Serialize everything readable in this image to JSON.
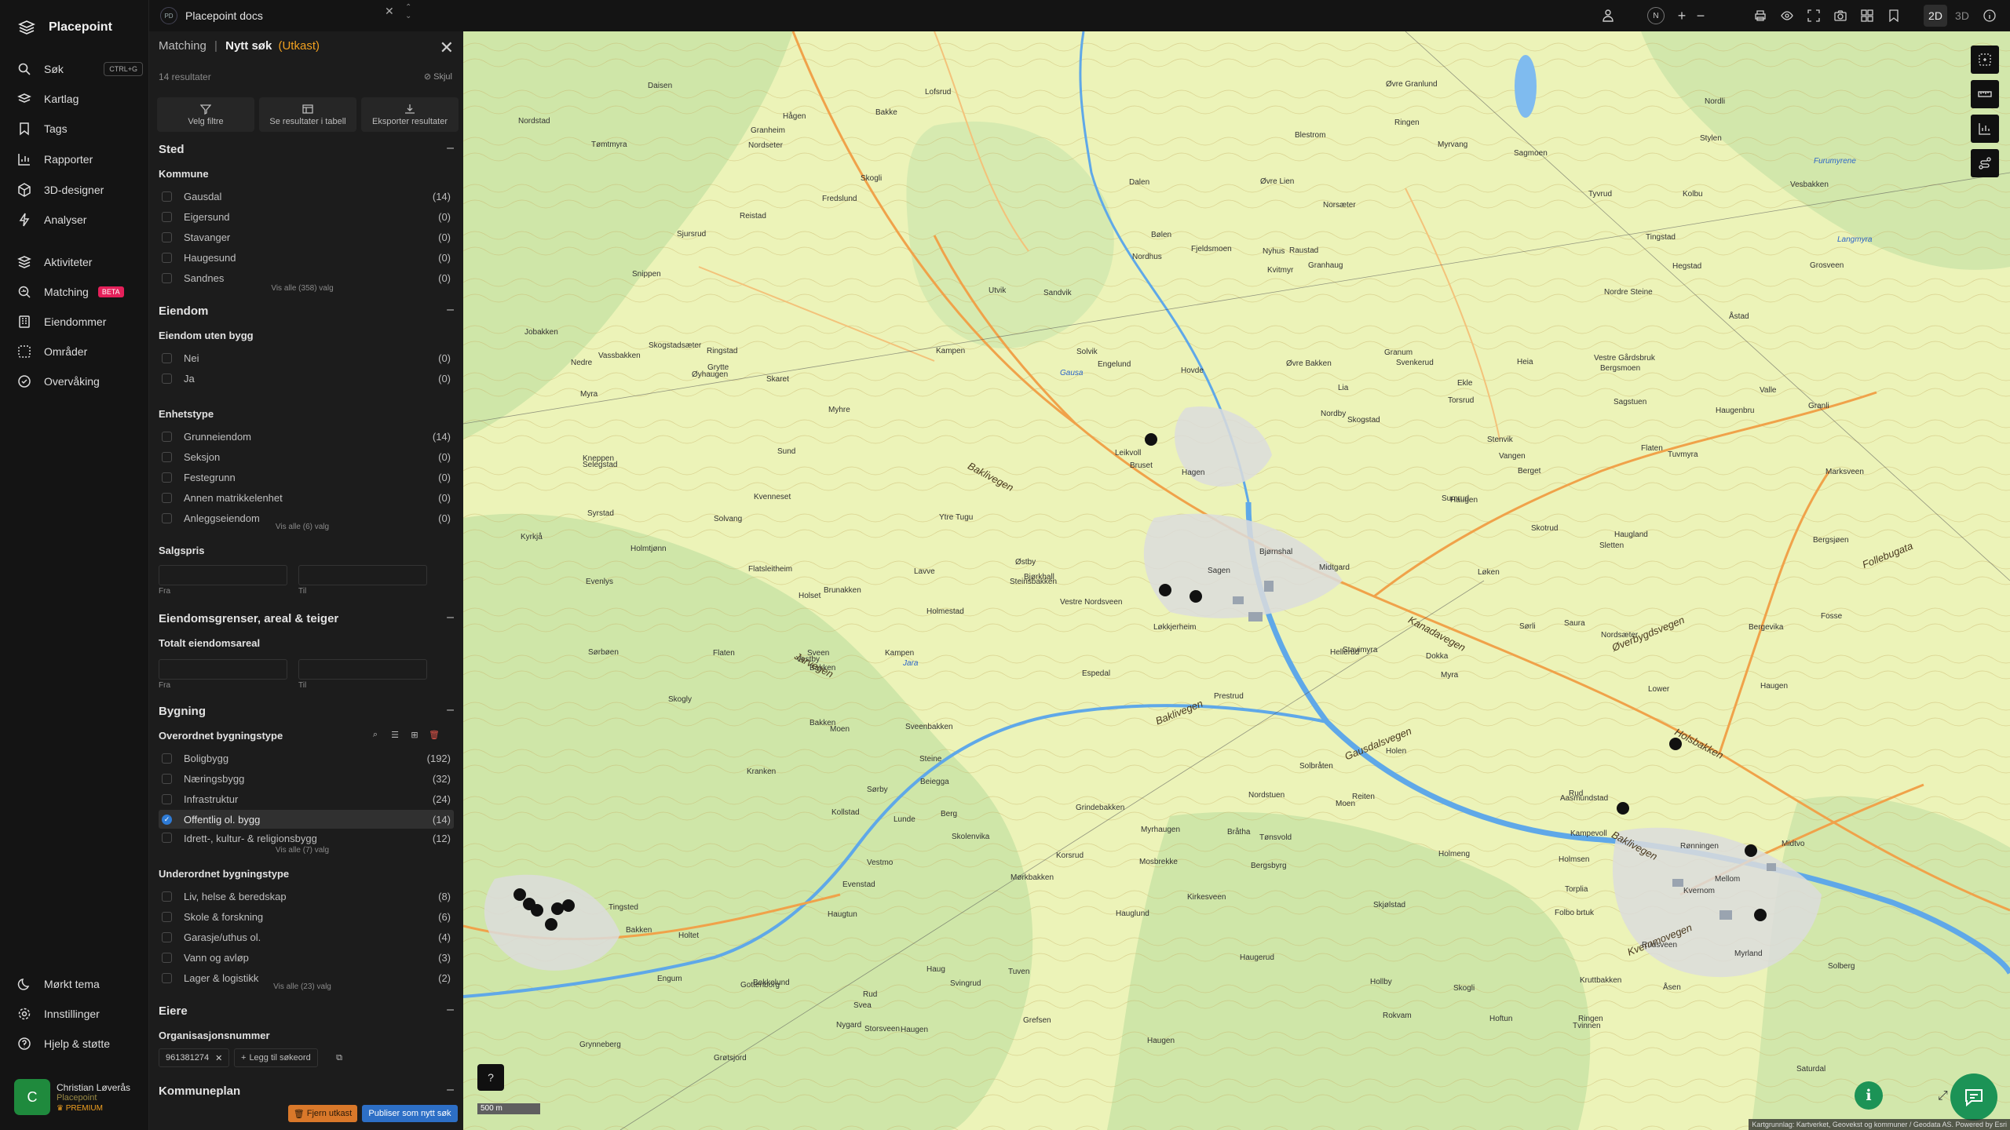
{
  "app": {
    "name": "Placepoint",
    "workspace": {
      "badge": "PD",
      "name": "Placepoint docs"
    }
  },
  "nav": {
    "items": [
      {
        "label": "Søk",
        "icon": "search-icon",
        "shortcut": "CTRL+G"
      },
      {
        "label": "Kartlag",
        "icon": "layers-icon"
      },
      {
        "label": "Tags",
        "icon": "bookmark-icon"
      },
      {
        "label": "Rapporter",
        "icon": "chart-icon"
      },
      {
        "label": "3D-designer",
        "icon": "cube-icon"
      },
      {
        "label": "Analyser",
        "icon": "lightning-icon"
      },
      {
        "label": "Aktiviteter",
        "icon": "stack-icon"
      },
      {
        "label": "Matching",
        "icon": "search-chart-icon",
        "badge": "BETA"
      },
      {
        "label": "Eiendommer",
        "icon": "building-icon"
      },
      {
        "label": "Områder",
        "icon": "area-icon"
      },
      {
        "label": "Overvåking",
        "icon": "monitor-icon"
      }
    ],
    "bottom": [
      {
        "label": "Mørkt tema",
        "icon": "moon-icon"
      },
      {
        "label": "Innstillinger",
        "icon": "gear-icon"
      },
      {
        "label": "Hjelp & støtte",
        "icon": "help-icon"
      }
    ],
    "user": {
      "initial": "C",
      "name": "Christian Løverås",
      "org": "Placepoint",
      "plan": "PREMIUM"
    }
  },
  "topbar": {
    "north": "N",
    "view_2d": "2D",
    "view_3d": "3D",
    "active_view": "2D"
  },
  "panel": {
    "crumb": "Matching",
    "separator": "|",
    "title": "Nytt søk",
    "status": "(Utkast)",
    "result_count": "14 resultater",
    "hide_label": "Skjul",
    "actions": [
      "Velg filtre",
      "Se resultater i tabell",
      "Eksporter resultater"
    ],
    "sections": {
      "sted": {
        "title": "Sted",
        "kommune": {
          "title": "Kommune",
          "rows": [
            {
              "label": "Gausdal",
              "count": "(14)"
            },
            {
              "label": "Eigersund",
              "count": "(0)"
            },
            {
              "label": "Stavanger",
              "count": "(0)"
            },
            {
              "label": "Haugesund",
              "count": "(0)"
            },
            {
              "label": "Sandnes",
              "count": "(0)"
            }
          ],
          "more": "Vis alle (358) valg"
        }
      },
      "eiendom": {
        "title": "Eiendom",
        "uten_bygg": {
          "title": "Eiendom uten bygg",
          "rows": [
            {
              "label": "Nei",
              "count": "(0)"
            },
            {
              "label": "Ja",
              "count": "(0)"
            }
          ]
        },
        "enhetstype": {
          "title": "Enhetstype",
          "rows": [
            {
              "label": "Grunneiendom",
              "count": "(14)"
            },
            {
              "label": "Seksjon",
              "count": "(0)"
            },
            {
              "label": "Festegrunn",
              "count": "(0)"
            },
            {
              "label": "Annen matrikkelenhet",
              "count": "(0)"
            },
            {
              "label": "Anleggseiendom",
              "count": "(0)"
            }
          ],
          "more": "Vis alle (6) valg"
        },
        "salgspris": {
          "title": "Salgspris",
          "from": "Fra",
          "to": "Til"
        }
      },
      "grenser": {
        "title": "Eiendomsgrenser, areal & teiger",
        "areal": {
          "title": "Totalt eiendomsareal",
          "from": "Fra",
          "to": "Til"
        }
      },
      "bygning": {
        "title": "Bygning",
        "overordnet": {
          "title": "Overordnet bygningstype",
          "rows": [
            {
              "label": "Boligbygg",
              "count": "(192)",
              "checked": false
            },
            {
              "label": "Næringsbygg",
              "count": "(32)",
              "checked": false
            },
            {
              "label": "Infrastruktur",
              "count": "(24)",
              "checked": false
            },
            {
              "label": "Offentlig ol. bygg",
              "count": "(14)",
              "checked": true
            },
            {
              "label": "Idrett-, kultur- & religionsbygg",
              "count": "(12)",
              "checked": false
            }
          ],
          "more": "Vis alle (7) valg"
        },
        "underordnet": {
          "title": "Underordnet bygningstype",
          "rows": [
            {
              "label": "Liv, helse & beredskap",
              "count": "(8)"
            },
            {
              "label": "Skole & forskning",
              "count": "(6)"
            },
            {
              "label": "Garasje/uthus ol.",
              "count": "(4)"
            },
            {
              "label": "Vann og avløp",
              "count": "(3)"
            },
            {
              "label": "Lager & logistikk",
              "count": "(2)"
            }
          ],
          "more": "Vis alle (23) valg"
        }
      },
      "eiere": {
        "title": "Eiere",
        "org": {
          "title": "Organisasjonsnummer",
          "chip": "961381274",
          "add_label": "Legg til søkeord"
        }
      },
      "kommuneplan": {
        "title": "Kommuneplan"
      }
    },
    "footer": {
      "remove": "Fjern utkast",
      "publish": "Publiser som nytt søk"
    }
  },
  "map": {
    "scale": "500 m",
    "attribution": "Kartgrunnlag: Kartverket, Geovekst og kommuner / Geodata AS. Powered by Esri",
    "place_labels": [
      "Kvernom",
      "Midtvo",
      "Nordstuen",
      "Blestrom",
      "Holmeng",
      "Torsrud",
      "Hoftun",
      "Solberg",
      "Reistad",
      "Skjølstad",
      "Solvang",
      "Lavve",
      "Ringen",
      "Bråtha",
      "Grindebakken",
      "Engum",
      "Nordhus",
      "Hegstad",
      "Skolenvika",
      "Bakke",
      "Grosveen",
      "Rokvam",
      "Sveenbakken",
      "Tømtmyra",
      "Korsrud",
      "Tuvmyra",
      "Bølen",
      "Haugen",
      "Holmestad",
      "Bergsbyrg",
      "Tønsvold",
      "Bergsjøen",
      "Lia",
      "Stavimyra",
      "Flatsleitheim",
      "Nordstad",
      "Leikvoll",
      "Storsveen",
      "Myra",
      "Bjørkhall",
      "Kvitmyr",
      "Holmtjønn",
      "Heia",
      "Vestre Nordsveen",
      "Hauglund",
      "Stylen",
      "Øyhaugen",
      "Myrhaugen",
      "Sjursrud",
      "Tingsted",
      "Løkkjerheim",
      "Kruttbakken",
      "Bjørnshal",
      "Nordsæter",
      "Moen",
      "Bergevika",
      "Tyvrud",
      "Aasmundstad",
      "Hagen",
      "Saura",
      "Skotrud",
      "Skogstad",
      "Snippen",
      "Fjeldsmoen",
      "Reiten",
      "Selegstad",
      "Utvik",
      "Rudsveen",
      "Kyrkjå",
      "Hollby",
      "Norsæter",
      "Lunde",
      "Myra",
      "Evenstad",
      "Sveen",
      "Lower",
      "Skogstadsæter",
      "Grytte",
      "Engelund",
      "Kirkesveen",
      "Sandvik",
      "Ringen",
      "Torplia",
      "Steine",
      "Svea",
      "Kampen",
      "Hågen",
      "Flaten",
      "Ytre Tugu",
      "Espedal",
      "Nordre Steine",
      "Kollstad",
      "Beiegga",
      "Raustad",
      "Mørkbakken",
      "Kranken",
      "Holmsen",
      "Grynneberg",
      "Tuven",
      "Berget",
      "Hellerud",
      "Bakken",
      "Sagstuen",
      "Grefsen",
      "Vassbakken",
      "Svingrud",
      "Haugen",
      "Fredslund",
      "Midtgard",
      "Haugenbru",
      "Evenlys",
      "Marksveen",
      "Lofsrud",
      "Rønningen",
      "Tvinnen",
      "Vestmo",
      "Jobakken",
      "Steinsbakken",
      "Daisen",
      "Vestre Gårdsbruk",
      "Kneppen",
      "Grøtsjord",
      "Granhaug",
      "Gottenborg",
      "Sagmoen",
      "Ekle",
      "Syrstad",
      "Bakken",
      "Haugen",
      "Nedre",
      "Myrland",
      "Brunakken",
      "Mosbrekke",
      "Ringstad",
      "Kampen",
      "Svenkerud",
      "Skogli",
      "Sørbøen",
      "Vesbakken",
      "Solbråten",
      "Kampevoll",
      "Dokka",
      "Bruset",
      "Tingstad",
      "Granheim",
      "Holset",
      "Øvre Lien",
      "Folbo brtuk",
      "Kvenneset",
      "Rud",
      "Bergsmoen",
      "Sumrud",
      "Haugen",
      "Moen",
      "Bakken",
      "Fosse",
      "Sagen",
      "Myrvang",
      "Øvre Granlund",
      "Åsen",
      "Flaten",
      "Holen",
      "Granli",
      "Kolbu",
      "Haug",
      "Nordseter",
      "Skogly",
      "Saturdal",
      "Haugland",
      "Åstad",
      "Valle",
      "Haugtun",
      "Øvre Bakken",
      "Nyhus",
      "Sørli",
      "Dalen",
      "Bekkelund",
      "Skogli",
      "Nordli",
      "Holtet",
      "Solvik",
      "Sund",
      "Stenvik",
      "Nygard",
      "Løken",
      "Berg",
      "Hovde",
      "Rud",
      "Myhre",
      "Prestrud",
      "Vangen",
      "Sletten",
      "Granum",
      "Mellom",
      "Østby",
      "Vestby",
      "Nordby",
      "Sørby",
      "Haugerud",
      "Skaret"
    ],
    "road_labels": [
      "Baklivegen",
      "Baklivegen",
      "Baklivegen",
      "Gausdalsvegen",
      "Kanadavegen",
      "Øverbygdsvegen",
      "Holsbakken",
      "Follebugata",
      "Jarvegen",
      "Kvernmovegen"
    ],
    "water_labels": [
      "Gausa",
      "Jara",
      "Furumyrene",
      "Langmyra"
    ],
    "tools": [
      "map-select-icon",
      "map-measure-icon",
      "map-chart-icon",
      "map-route-icon"
    ]
  }
}
